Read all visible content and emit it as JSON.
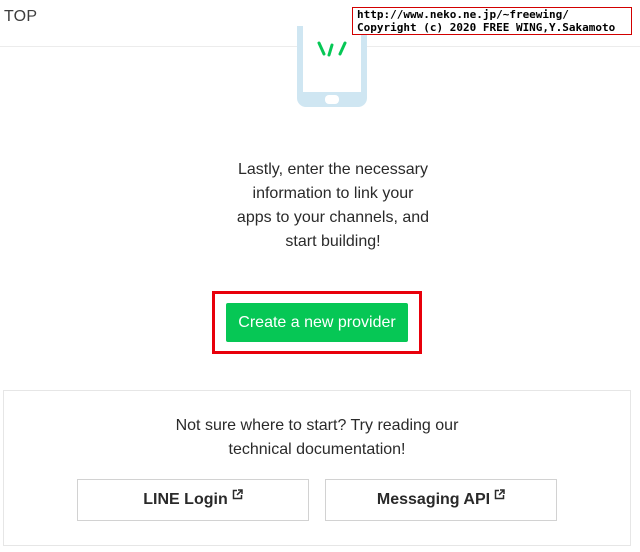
{
  "header": {
    "nav_top": "TOP"
  },
  "watermark": {
    "line1": "http://www.neko.ne.jp/~freewing/",
    "line2": "Copyright (c) 2020 FREE WING,Y.Sakamoto"
  },
  "illustration": {
    "icon": "phone-code-icon"
  },
  "intro": {
    "lines": [
      "Lastly, enter the necessary",
      "information to link your",
      "apps to your channels, and",
      "start building!"
    ]
  },
  "create_provider": {
    "label": "Create a new provider"
  },
  "docs": {
    "lines": [
      "Not sure where to start? Try reading our",
      "technical documentation!"
    ],
    "links": [
      {
        "label": "LINE Login",
        "icon": "external-link-icon"
      },
      {
        "label": "Messaging API",
        "icon": "external-link-icon"
      }
    ]
  },
  "colors": {
    "primary_green": "#06c755",
    "highlight_red": "#e8000b",
    "phone_blue": "#cfe6f2"
  }
}
